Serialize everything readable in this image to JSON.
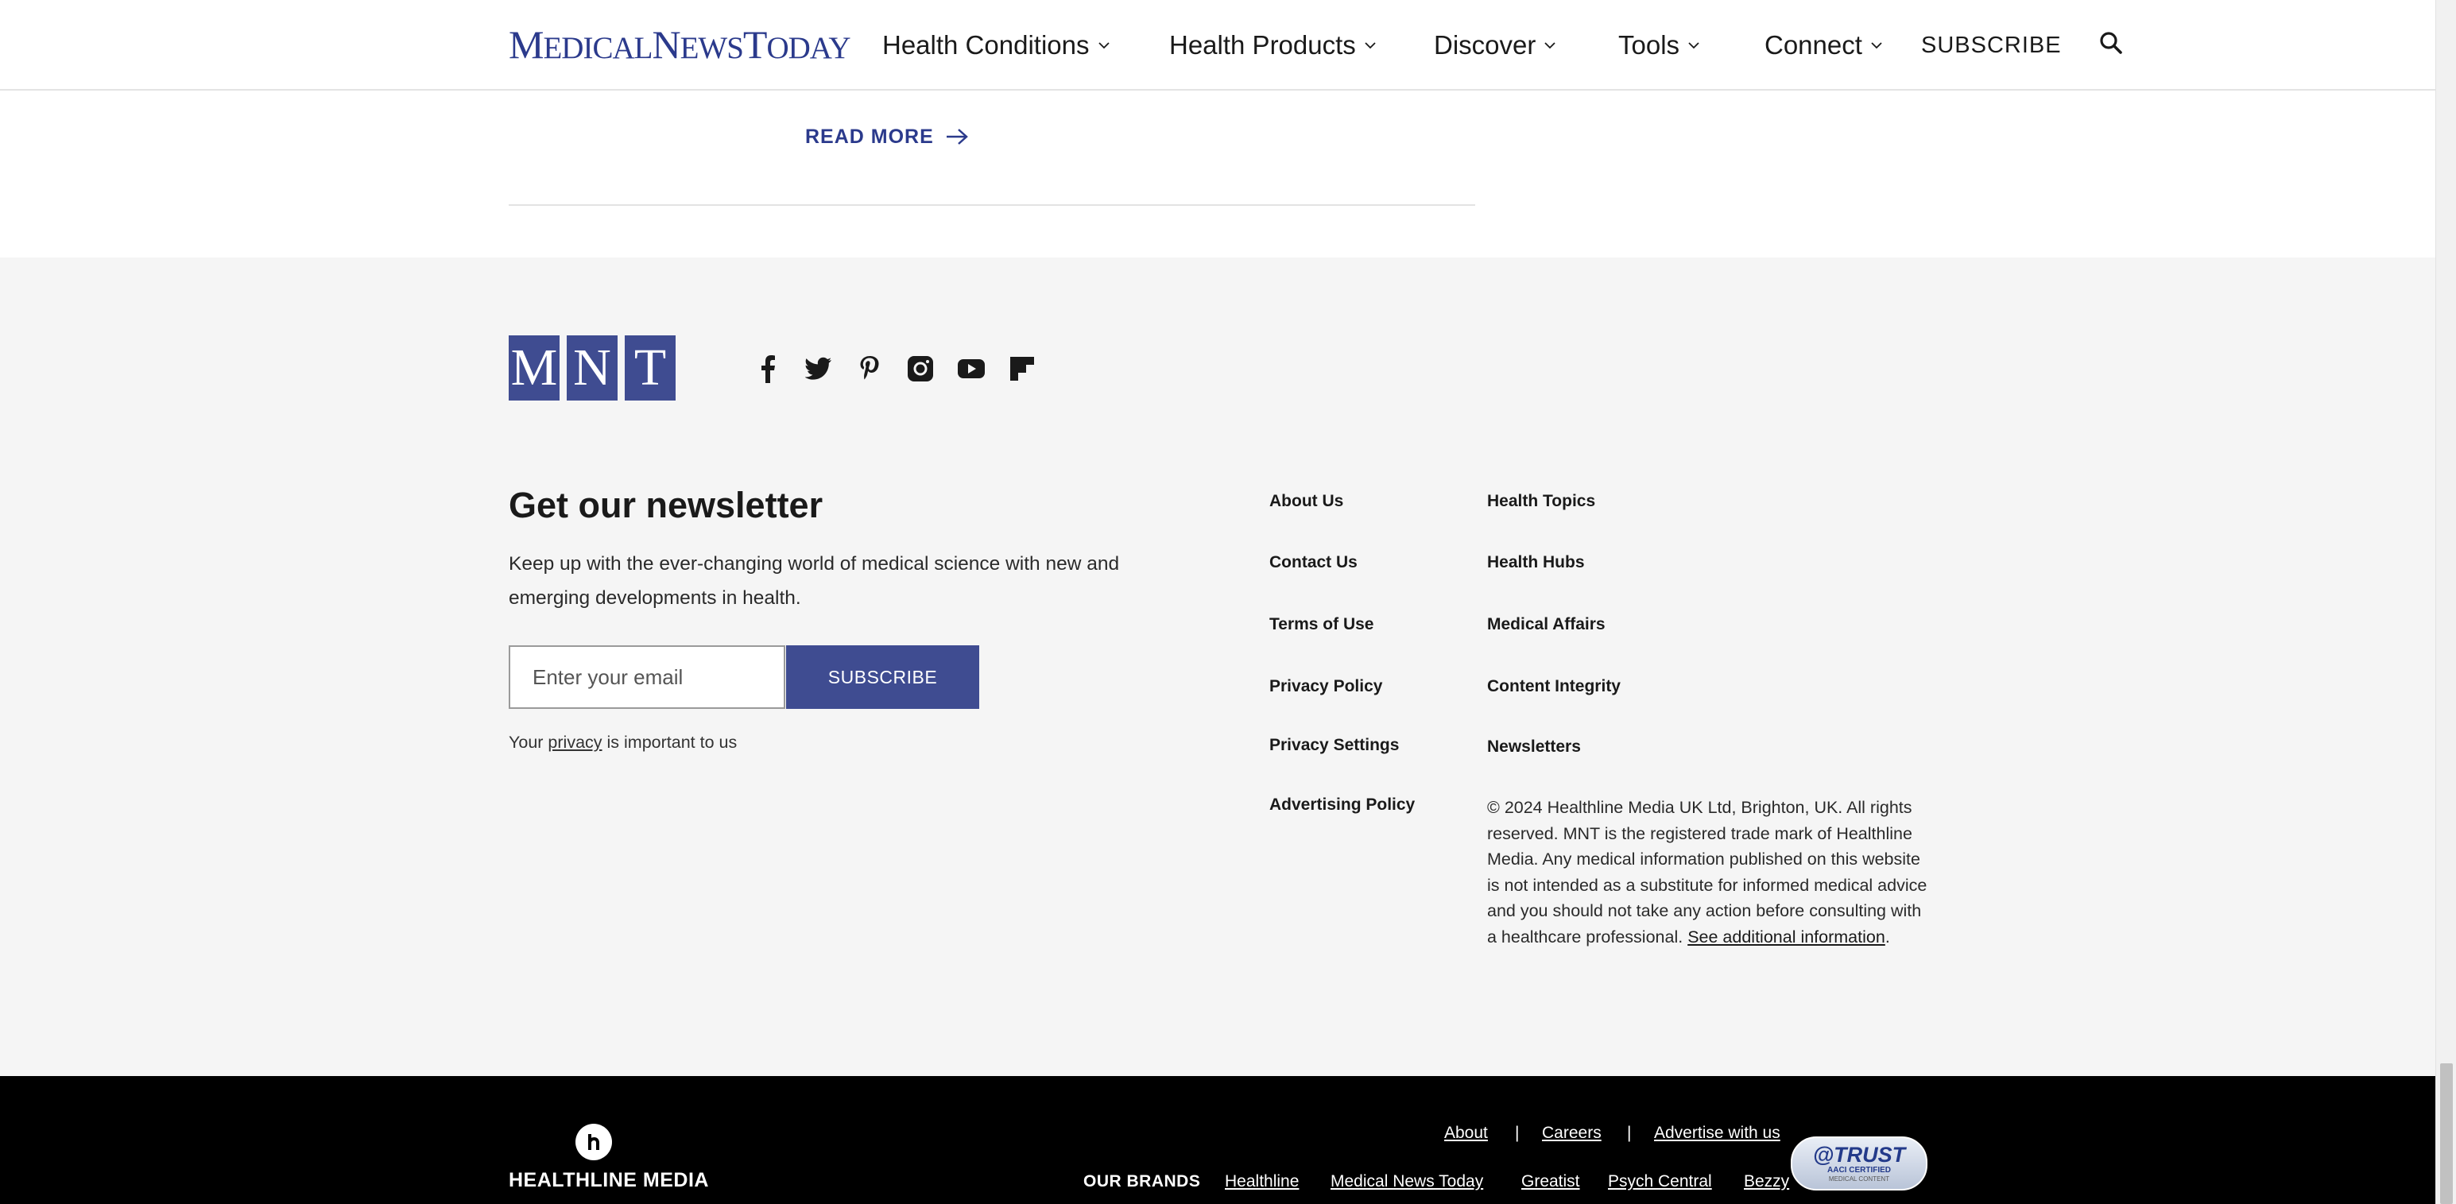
{
  "nav": {
    "logo": {
      "m1": "M",
      "rest1": "EDICAL",
      "n": "N",
      "rest2": "EWS",
      "t": "T",
      "rest3": "ODAY"
    },
    "items": [
      {
        "label": "Health Conditions"
      },
      {
        "label": "Health Products"
      },
      {
        "label": "Discover"
      },
      {
        "label": "Tools"
      },
      {
        "label": "Connect"
      }
    ],
    "subscribe_label": "SUBSCRIBE",
    "search_icon": "search-icon"
  },
  "article": {
    "read_more_label": "READ MORE"
  },
  "footer": {
    "mnt_letters": [
      "M",
      "N",
      "T"
    ],
    "socials": [
      "facebook-icon",
      "twitter-icon",
      "pinterest-icon",
      "instagram-icon",
      "youtube-icon",
      "flipboard-icon"
    ],
    "newsletter": {
      "title": "Get our newsletter",
      "description": "Keep up with the ever-changing world of medical science with new and emerging developments in health.",
      "email_placeholder": "Enter your email",
      "subscribe_label": "SUBSCRIBE",
      "privacy_prefix": "Your ",
      "privacy_link": "privacy",
      "privacy_suffix": " is important to us"
    },
    "links_col1": [
      "About Us",
      "Contact Us",
      "Terms of Use",
      "Privacy Policy",
      "Privacy Settings",
      "Advertising Policy"
    ],
    "links_col2": [
      "Health Topics",
      "Health Hubs",
      "Medical Affairs",
      "Content Integrity",
      "Newsletters"
    ],
    "copyright_text": "© 2024 Healthline Media UK Ltd, Brighton, UK. All rights reserved. MNT is the registered trade mark of Healthline Media. Any medical information published on this website is not intended as a substitute for informed medical advice and you should not take any action before consulting with a healthcare professional.",
    "copyright_link": "See additional information",
    "copyright_end": "."
  },
  "bottom": {
    "logo_text": "HEALTHLINE MEDIA",
    "top_links": [
      "About",
      "Careers",
      "Advertise with us"
    ],
    "separator": "|",
    "brands_label": "OUR BRANDS",
    "brands": [
      "Healthline",
      "Medical News Today",
      "Greatist",
      "Psych Central",
      "Bezzy"
    ],
    "trust_badge": {
      "title": "@TRUST",
      "line2": "AACI CERTIFIED",
      "line3": "MEDICAL CONTENT"
    }
  },
  "colors": {
    "brand_blue": "#3f4c91",
    "logo_blue": "#2b3a8c",
    "footer_bg": "#f5f5f5",
    "bottom_bg": "#000000"
  }
}
